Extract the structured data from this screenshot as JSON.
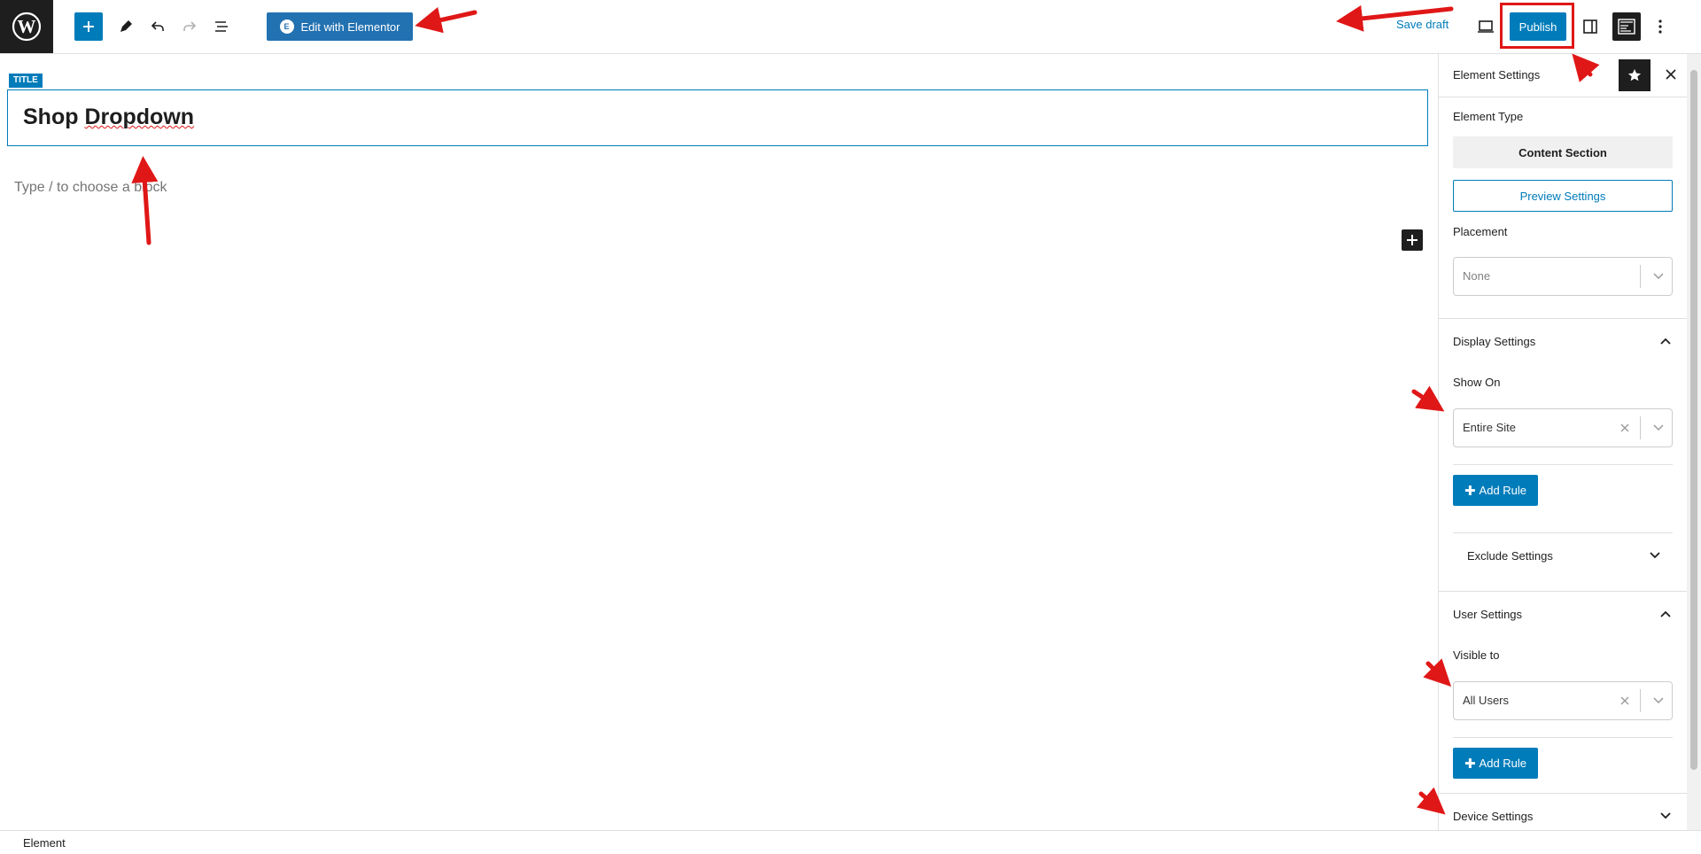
{
  "toolbar": {
    "edit_with_elementor": "Edit with Elementor",
    "elementor_badge": "E",
    "save_draft": "Save draft",
    "publish": "Publish"
  },
  "editor": {
    "title_tag": "TITLE",
    "title_word1": "Shop",
    "title_word2": "Dropdown",
    "block_placeholder": "Type / to choose a block"
  },
  "sidebar": {
    "header_title": "Element Settings",
    "element_type_label": "Element Type",
    "element_type_value": "Content Section",
    "preview_settings": "Preview Settings",
    "placement_label": "Placement",
    "placement_value": "None",
    "display_settings": {
      "title": "Display Settings",
      "show_on_label": "Show On",
      "show_on_value": "Entire Site",
      "add_rule": "Add Rule",
      "exclude_settings": "Exclude Settings"
    },
    "user_settings": {
      "title": "User Settings",
      "visible_to_label": "Visible to",
      "visible_to_value": "All Users",
      "add_rule": "Add Rule"
    },
    "device_settings": {
      "title": "Device Settings"
    }
  },
  "footer": {
    "breadcrumb": "Element"
  },
  "colors": {
    "accent": "#007cba",
    "elementor_blue": "#2271b1",
    "annotation_red": "#e01717",
    "dark": "#1e1e1e"
  },
  "icons": [
    "wordpress-logo-icon",
    "plus-icon",
    "pencil-icon",
    "undo-icon",
    "redo-icon",
    "list-view-icon",
    "elementor-icon",
    "desktop-preview-icon",
    "sidebar-toggle-icon",
    "ui-fill-icon",
    "more-vertical-icon",
    "star-icon",
    "close-icon",
    "chevron-down-icon",
    "chevron-up-icon",
    "clear-x-icon"
  ]
}
